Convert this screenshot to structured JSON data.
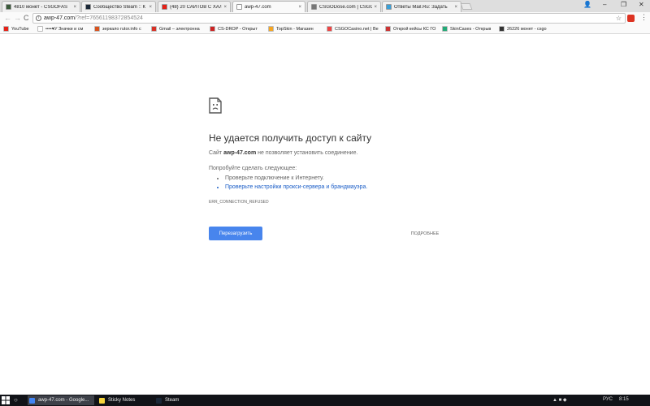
{
  "tabs": [
    {
      "title": "4810 монет - CSGOFAS",
      "favicon_color": "#3a5a3a"
    },
    {
      "title": "Сообщество Steam :: К",
      "favicon_color": "#1b2838"
    },
    {
      "title": "(48) 20 САЙТОВ С ХАЛ",
      "favicon_color": "#e62117"
    },
    {
      "title": "awp-47.com",
      "favicon_color": "#ffffff",
      "active": true
    },
    {
      "title": "CSGODose.com | CSGO",
      "favicon_color": "#777777"
    },
    {
      "title": "Ответы Mail.Ru: Задать",
      "favicon_color": "#3aa0d8"
    }
  ],
  "tab_close": "×",
  "window_controls": {
    "user": "👤",
    "minimize": "–",
    "restore": "❐",
    "close": "✕"
  },
  "nav": {
    "back": "←",
    "forward": "→",
    "reload": "C"
  },
  "omnibox": {
    "host": "awp-47.com",
    "path": "/?ref=76561198372854524",
    "info": "i"
  },
  "toolbar_icons": {
    "star": "☆",
    "menu": "⋮"
  },
  "bookmarks": [
    {
      "label": "YouTube",
      "color": "#e62117"
    },
    {
      "label": "••••♥У Значки и см",
      "color": "#ffffff"
    },
    {
      "label": "зеркало rutor.info с",
      "color": "#d9531e"
    },
    {
      "label": "Gmail – электронна",
      "color": "#d93025"
    },
    {
      "label": "CS-DROP - Открыт",
      "color": "#c22"
    },
    {
      "label": "TopSkin - Магазин",
      "color": "#f5a623"
    },
    {
      "label": "CSGOCasino.net | Be",
      "color": "#e44"
    },
    {
      "label": "Открой кейсы КС ГО",
      "color": "#c33"
    },
    {
      "label": "SkinCases - Открыв",
      "color": "#2a7"
    },
    {
      "label": "26226 монет - csgo",
      "color": "#333"
    }
  ],
  "error": {
    "title": "Не удается получить доступ к сайту",
    "host": "awp-47.com",
    "desc_prefix": "Сайт",
    "desc_suffix": "не позволяет установить соединение.",
    "try_label": "Попробуйте сделать следующее:",
    "suggestions": [
      "Проверьте подключение к Интернету.",
      "Проверьте настройки прокси-сервера и брандмауэра."
    ],
    "code": "ERR_CONNECTION_REFUSED",
    "reload_label": "Перезагрузить",
    "details_label": "ПОДРОБНЕЕ"
  },
  "taskbar": {
    "search_icon": "○",
    "items": [
      {
        "label": "awp-47.com - Google...",
        "color": "#4285f4",
        "active": true
      },
      {
        "label": "Sticky Notes",
        "color": "#f6d43c"
      },
      {
        "label": "Steam",
        "color": "#1b2838"
      }
    ],
    "lang": "РУС",
    "time": "8:15"
  }
}
